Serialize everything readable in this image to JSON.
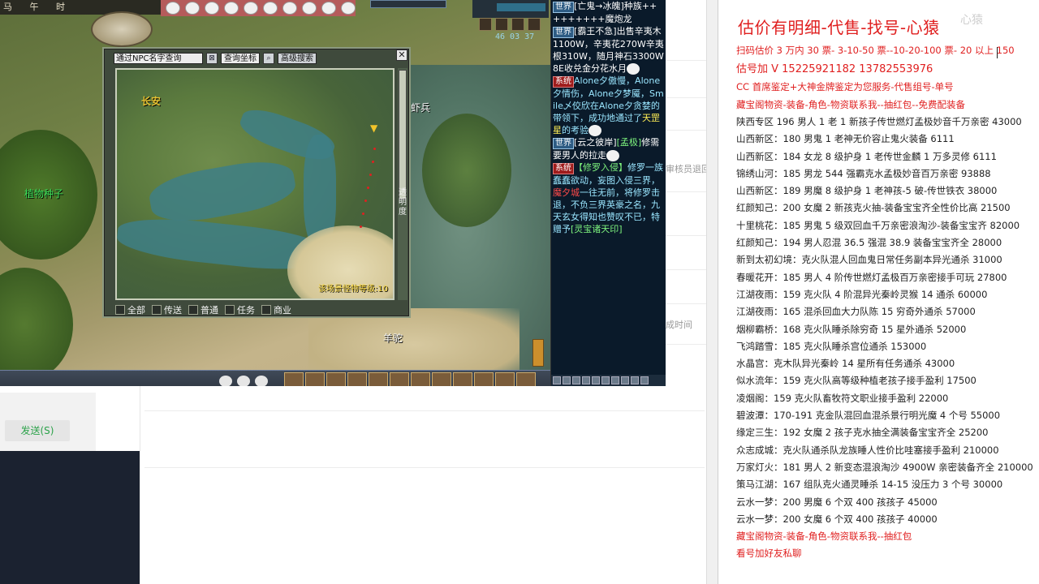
{
  "game": {
    "top_strip": [
      "马",
      "午",
      "时"
    ],
    "clock": "46 03 37",
    "scene_labels": {
      "plant_seed": "植物种子",
      "shrimp_soldier": "虾兵",
      "sheep_demon": "羊驼"
    },
    "map_dialog": {
      "npc_search_placeholder": "通过NPC名字查询",
      "coord_query_label": "查询坐标",
      "advanced_search_label": "高级搜索",
      "close_glyph": "✕",
      "city_label": "长安",
      "level_text": "该场景怪物等级:10",
      "transparency_label": "透明度",
      "filters": [
        "全部",
        "传送",
        "普通",
        "任务",
        "商业"
      ]
    }
  },
  "chat": {
    "messages": [
      {
        "tag": "世界",
        "parts": [
          {
            "t": "[亡鬼→冰魄]种族+++++++++魔炮龙",
            "c": ""
          }
        ]
      },
      {
        "tag": "世界",
        "parts": [
          {
            "t": "[霸王不急]出售辛夷木1100W，辛夷花270W辛夷根310W，随月神石3300W",
            "c": ""
          },
          {
            "t": " 8E收兑金分花水月",
            "c": ""
          }
        ]
      },
      {
        "tag": "系统",
        "parts": [
          {
            "t": "Alone夕傲慢，Alone夕情伤，Alone夕梦魇，Smile乄佼欣在Alone夕贪婪的带领下，成功地通过了",
            "c": "c-cyan"
          },
          {
            "t": "天罡星",
            "c": "c-yellow"
          },
          {
            "t": "的考验",
            "c": "c-cyan"
          }
        ]
      },
      {
        "tag": "世界",
        "parts": [
          {
            "t": "[云之彼岸]",
            "c": ""
          },
          {
            "t": "[孟极]",
            "c": "c-green"
          },
          {
            "t": "修需要男人的拉走",
            "c": ""
          }
        ]
      },
      {
        "tag": "系统",
        "parts": [
          {
            "t": "【修罗入侵】",
            "c": "c-green"
          },
          {
            "t": "修罗一族蠢蠢欲动，妄图入侵三界，",
            "c": "c-cyan"
          },
          {
            "t": "魔夕城",
            "c": "c-red"
          },
          {
            "t": "一往无前，将修罗击退，不负三界英豪之名，九天玄女得知也赞叹不已，特赠予",
            "c": "c-cyan"
          },
          {
            "t": "[灵宝诸天印]",
            "c": "c-green"
          }
        ]
      }
    ]
  },
  "web": {
    "send_button": "发送(S)",
    "faint_text_1": "审核员退回",
    "faint_text_2": "成时间"
  },
  "notes": {
    "title": "估价有明细-代售-找号-心猿",
    "watermark": "心猿",
    "lines": [
      {
        "text": "扫码估价 3 万内 30 票- 3-10-50 票--10-20-100 票- 20 以上 150",
        "red": true,
        "big": false
      },
      {
        "text": "估号加 V 15225921182    13782553976",
        "red": true,
        "big": true
      },
      {
        "text": "CC 首席鉴定+大神金牌鉴定为您服务-代售组号-单号",
        "red": true,
        "big": false
      },
      {
        "text": "藏宝阁物资-装备-角色-物资联系我--抽红包--免费配装备",
        "red": true,
        "big": false
      },
      {
        "text": "陕西专区 196 男人 1 老 1 新孩子传世燃灯孟极妙音千万亲密 43000",
        "red": false,
        "big": false
      },
      {
        "text": "山西新区：180 男鬼 1 老神无价容止鬼火装备 6111",
        "red": false,
        "big": false
      },
      {
        "text": "山西新区：184 女龙 8 级护身 1 老传世金麟 1 万多灵修 6111",
        "red": false,
        "big": false
      },
      {
        "text": "锦绣山河：185 男龙 544 强霸克水孟极妙音百万亲密 93888",
        "red": false,
        "big": false
      },
      {
        "text": "山西新区：189 男魔 8 级护身 1 老神孩-5 破-传世铁衣 38000",
        "red": false,
        "big": false
      },
      {
        "text": "红颜知己：200 女魔 2 新孩克火抽-装备宝宝齐全性价比高 21500",
        "red": false,
        "big": false
      },
      {
        "text": "十里桃花：185 男鬼 5 级双回血千万亲密浪淘沙-装备宝宝齐 82000",
        "red": false,
        "big": false
      },
      {
        "text": "红颜知己：194 男人忍混 36.5 强混 38.9 装备宝宝齐全 28000",
        "red": false,
        "big": false
      },
      {
        "text": "新到太初幻境：克火队混人回血鬼日常任务副本异光通杀 31000",
        "red": false,
        "big": false
      },
      {
        "text": "春暖花开：185 男人 4 阶传世燃灯孟极百万亲密接手可玩 27800",
        "red": false,
        "big": false
      },
      {
        "text": "江湖夜雨：159 克火队 4 阶混异光秦岭灵猴 14 通杀 60000",
        "red": false,
        "big": false
      },
      {
        "text": "江湖夜雨：165 混杀回血大力队陈 15 穷奇外通杀 57000",
        "red": false,
        "big": false
      },
      {
        "text": "烟柳霸桥：168 克火队睡杀除穷奇 15 星外通杀 52000",
        "red": false,
        "big": false
      },
      {
        "text": "飞鸿踏雪：185 克火队睡杀宫位通杀 153000",
        "red": false,
        "big": false
      },
      {
        "text": "水晶宫：克木队异光秦岭 14 星所有任务通杀 43000",
        "red": false,
        "big": false
      },
      {
        "text": "似水流年：159 克火队高等级种植老孩子接手盈利 17500",
        "red": false,
        "big": false
      },
      {
        "text": "凌烟阁：159 克火队畜牧符文职业接手盈利 22000",
        "red": false,
        "big": false
      },
      {
        "text": "碧波潭：170-191 克金队混回血混杀景行明光魔 4 个号 55000",
        "red": false,
        "big": false
      },
      {
        "text": "缘定三生：192 女魔 2 孩子克水抽全满装备宝宝齐全 25200",
        "red": false,
        "big": false
      },
      {
        "text": "众志成城：克火队通杀队龙族睡人性价比哇塞接手盈利 210000",
        "red": false,
        "big": false
      },
      {
        "text": "万家灯火：181 男人 2 新变态混浪淘沙 4900W 亲密装备齐全 210000",
        "red": false,
        "big": false
      },
      {
        "text": "策马江湖：167 组队克火通灵睡杀 14-15 没压力 3 个号 30000",
        "red": false,
        "big": false
      },
      {
        "text": "云水一梦：200 男魔 6 个双 400 孩孩子 45000",
        "red": false,
        "big": false
      },
      {
        "text": "云水一梦：200 女魔 6 个双 400 孩孩子 40000",
        "red": false,
        "big": false
      },
      {
        "text": "藏宝阁物资-装备-角色-物资联系我--抽红包",
        "red": true,
        "big": false
      },
      {
        "text": "看号加好友私聊",
        "red": true,
        "big": false
      }
    ]
  }
}
